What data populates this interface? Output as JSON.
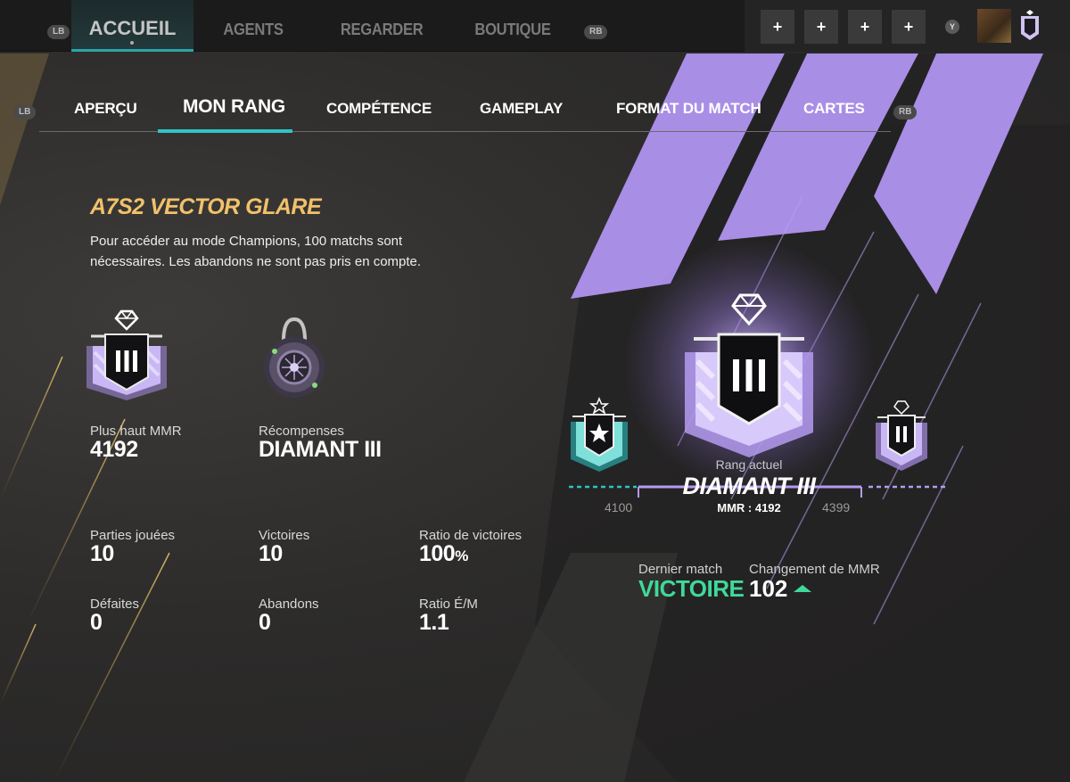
{
  "topnav": {
    "lb": "LB",
    "rb": "RB",
    "items": [
      {
        "label": "ACCUEIL",
        "active": true
      },
      {
        "label": "AGENTS"
      },
      {
        "label": "REGARDER"
      },
      {
        "label": "BOUTIQUE"
      }
    ],
    "quick_buttons": [
      "+",
      "+",
      "+",
      "+"
    ],
    "y_button": "Y"
  },
  "subnav": {
    "lb": "LB",
    "rb": "RB",
    "items": [
      {
        "label": "APERÇU"
      },
      {
        "label": "MON RANG",
        "active": true
      },
      {
        "label": "COMPÉTENCE"
      },
      {
        "label": "GAMEPLAY"
      },
      {
        "label": "FORMAT DU MATCH"
      },
      {
        "label": "CARTES"
      }
    ]
  },
  "season": {
    "title": "A7S2 VECTOR GLARE",
    "description": "Pour accéder au mode Champions, 100 matchs sont nécessaires. Les abandons ne sont pas pris en compte."
  },
  "highlights": {
    "highest_mmr_label": "Plus haut MMR",
    "highest_mmr_value": "4192",
    "rewards_label": "Récompenses",
    "rewards_value": "DIAMANT III"
  },
  "stats": [
    {
      "label": "Parties jouées",
      "value": "10"
    },
    {
      "label": "Victoires",
      "value": "10"
    },
    {
      "label": "Ratio de victoires",
      "value": "100",
      "unit": "%"
    },
    {
      "label": "Défaites",
      "value": "0"
    },
    {
      "label": "Abandons",
      "value": "0"
    },
    {
      "label": "Ratio É/M",
      "value": "1.1"
    }
  ],
  "rank": {
    "caption": "Rang actuel",
    "name": "DIAMANT III",
    "mmr": "MMR : 4192",
    "lower_bound": "4100",
    "upper_bound": "4399"
  },
  "last_match": {
    "label": "Dernier match",
    "result": "VICTOIRE",
    "mmr_change_label": "Changement de MMR",
    "mmr_change_value": "102"
  },
  "colors": {
    "accent_teal": "#2ec4c4",
    "season_gold": "#f2c16a",
    "rank_purple": "#a98ee6",
    "victory_green": "#3fd99a"
  }
}
